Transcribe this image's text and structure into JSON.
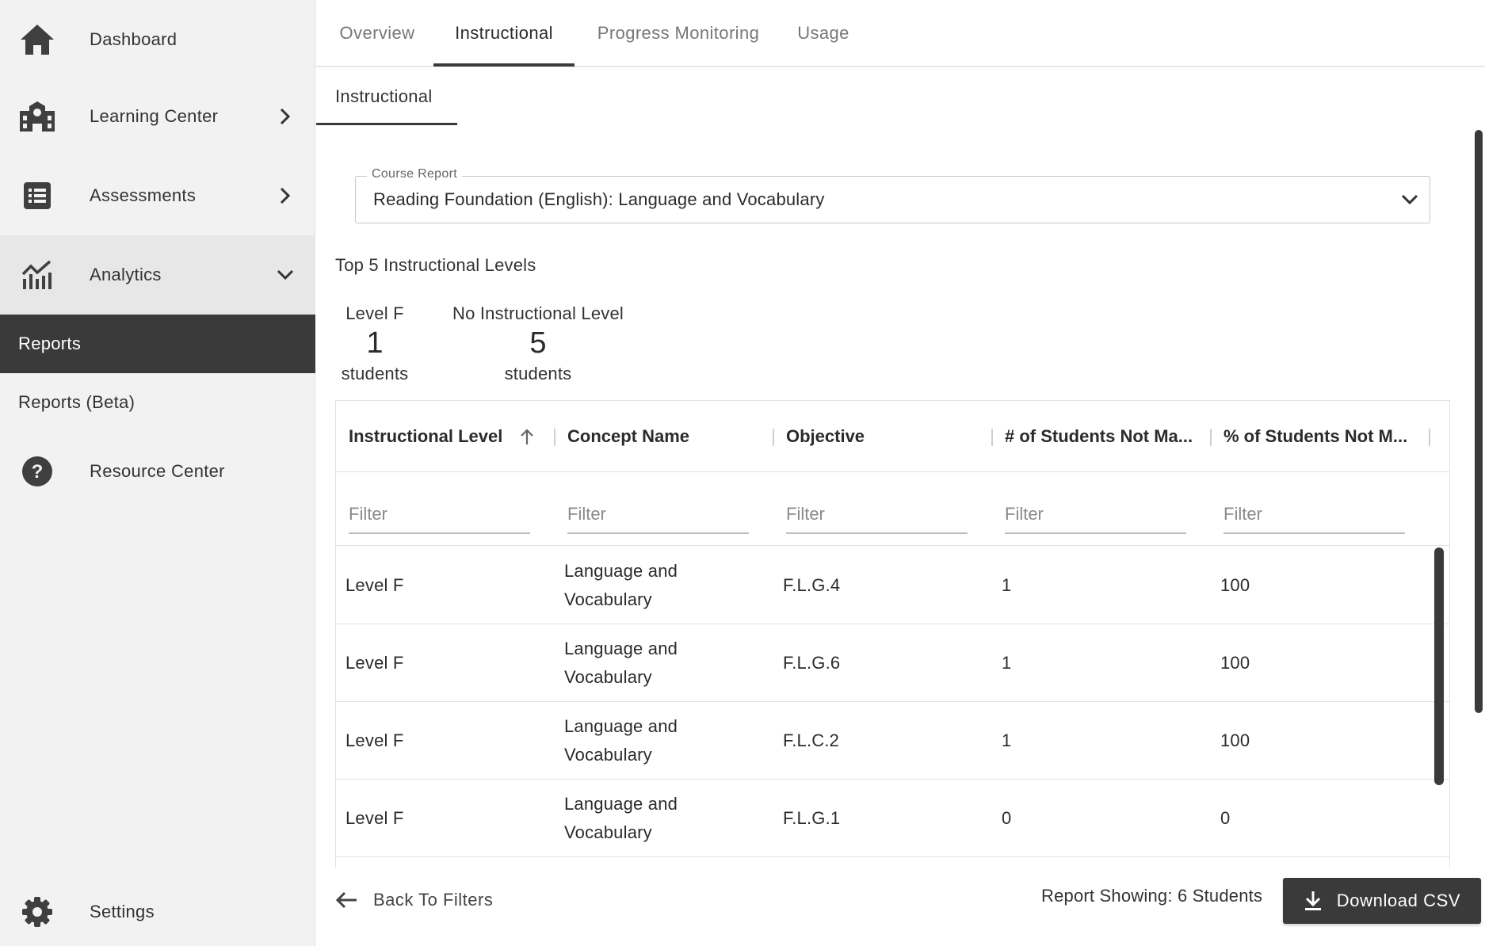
{
  "sidebar": {
    "items": [
      {
        "label": "Dashboard",
        "icon": "home-icon"
      },
      {
        "label": "Learning Center",
        "icon": "school-icon"
      },
      {
        "label": "Assessments",
        "icon": "list-icon"
      },
      {
        "label": "Analytics",
        "icon": "analytics-icon"
      }
    ],
    "sub_items": [
      {
        "label": "Reports",
        "active": true
      },
      {
        "label": "Reports (Beta)",
        "active": false
      }
    ],
    "resource_center": "Resource Center",
    "settings": "Settings"
  },
  "tabs": [
    {
      "label": "Overview"
    },
    {
      "label": "Instructional",
      "active": true
    },
    {
      "label": "Progress Monitoring"
    },
    {
      "label": "Usage"
    }
  ],
  "subtab": "Instructional",
  "course_select": {
    "legend": "Course Report",
    "value": "Reading Foundation (English): Language and Vocabulary"
  },
  "top_levels": {
    "title": "Top 5 Instructional Levels",
    "stats": [
      {
        "label": "Level F",
        "count": "1",
        "unit": "students"
      },
      {
        "label": "No Instructional Level",
        "count": "5",
        "unit": "students"
      }
    ]
  },
  "table": {
    "columns": [
      "Instructional Level",
      "Concept Name",
      "Objective",
      "# of Students Not Ma...",
      "% of Students Not M..."
    ],
    "filter_placeholder": "Filter",
    "rows": [
      [
        "Level F",
        "Language and Vocabulary",
        "F.L.G.4",
        "1",
        "100"
      ],
      [
        "Level F",
        "Language and Vocabulary",
        "F.L.G.6",
        "1",
        "100"
      ],
      [
        "Level F",
        "Language and Vocabulary",
        "F.L.C.2",
        "1",
        "100"
      ],
      [
        "Level F",
        "Language and Vocabulary",
        "F.L.G.1",
        "0",
        "0"
      ]
    ]
  },
  "footer": {
    "back_label": "Back To Filters",
    "report_count": "Report Showing: 6 Students",
    "download_label": "Download CSV"
  },
  "colors": {
    "sidebar_bg": "#f2f2f2",
    "active_bg": "#3a3a3a",
    "accent": "#3a3a3a"
  }
}
